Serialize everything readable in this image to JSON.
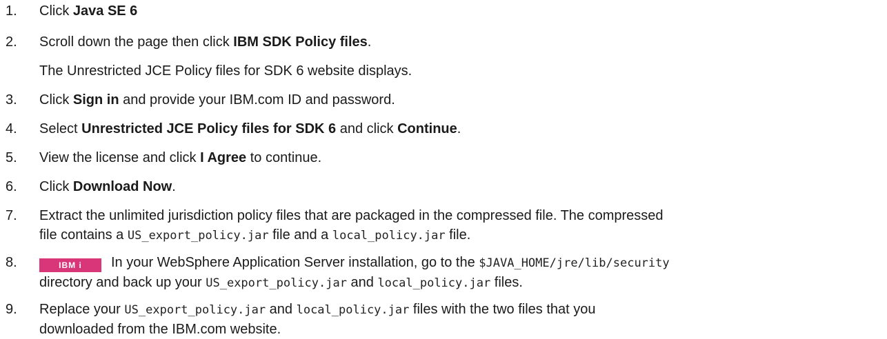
{
  "steps": [
    {
      "num": "1.",
      "pre": "Click ",
      "b1": "Java SE 6"
    },
    {
      "num": "2.",
      "pre": "Scroll down the page then click ",
      "b1": "IBM SDK Policy files",
      "post": ".",
      "sub": "The Unrestricted JCE Policy files for SDK 6 website displays."
    },
    {
      "num": "3.",
      "pre": "Click ",
      "b1": "Sign in",
      "post": " and provide your IBM.com ID and password."
    },
    {
      "num": "4.",
      "pre": "Select ",
      "b1": "Unrestricted JCE Policy files for SDK 6",
      "mid": " and click ",
      "b2": "Continue",
      "post": "."
    },
    {
      "num": "5.",
      "pre": "View the license and click ",
      "b1": "I Agree",
      "post": " to continue."
    },
    {
      "num": "6.",
      "pre": "Click ",
      "b1": "Download Now",
      "post": "."
    },
    {
      "num": "7.",
      "line1": "Extract the unlimited jurisdiction policy files that are packaged in the compressed file. The compressed",
      "l2a": "file contains a ",
      "code1": "US_export_policy.jar",
      "l2b": " file and a ",
      "code2": "local_policy.jar",
      "l2c": " file."
    },
    {
      "num": "8.",
      "badge": "IBM i",
      "l1a": "In your WebSphere Application Server installation, go to the ",
      "code1": "$JAVA_HOME/jre/lib/security",
      "l2a": "directory and back up your ",
      "code2": "US_export_policy.jar",
      "l2b": " and ",
      "code3": "local_policy.jar",
      "l2c": " files."
    },
    {
      "num": "9.",
      "l1a": "Replace your ",
      "code1": "US_export_policy.jar",
      "l1b": " and ",
      "code2": "local_policy.jar",
      "l1c": " files with the two files that you",
      "line2": "downloaded from the IBM.com website."
    }
  ]
}
